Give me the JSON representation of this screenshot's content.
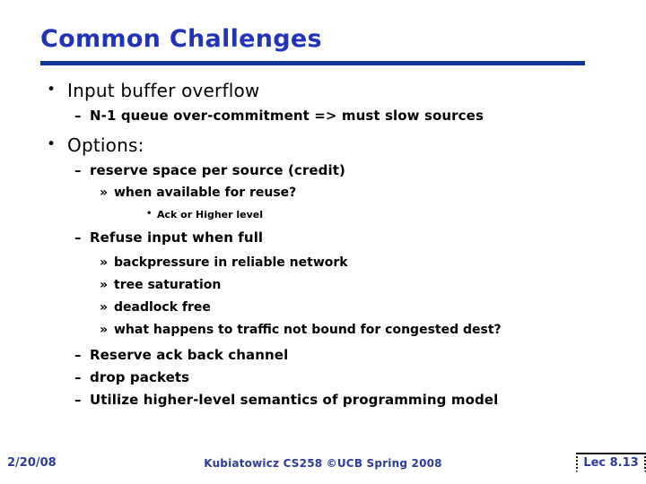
{
  "slide": {
    "title": "Common Challenges",
    "title_color": "#2233bb",
    "rule_color": "#123399",
    "outline": [
      {
        "level": 1,
        "bullet": "•",
        "text": "Input buffer overflow"
      },
      {
        "level": 2,
        "bullet": "–",
        "text": "N-1 queue over-commitment => must slow sources"
      },
      {
        "level": 1,
        "bullet": "•",
        "text": "Options:"
      },
      {
        "level": 2,
        "bullet": "–",
        "text": "reserve space per source  (credit)"
      },
      {
        "level": 3,
        "bullet": "»",
        "text": "when available for reuse?"
      },
      {
        "level": 4,
        "bullet": "•",
        "text": "Ack or Higher level"
      },
      {
        "level": 2,
        "bullet": "–",
        "text": "Refuse input when full"
      },
      {
        "level": 3,
        "bullet": "»",
        "text": "backpressure in reliable network"
      },
      {
        "level": 3,
        "bullet": "»",
        "text": "tree saturation"
      },
      {
        "level": 3,
        "bullet": "»",
        "text": "deadlock free"
      },
      {
        "level": 3,
        "bullet": "»",
        "text": "what happens to traffic not bound for congested dest?"
      },
      {
        "level": 2,
        "bullet": "–",
        "text": "Reserve ack back channel"
      },
      {
        "level": 2,
        "bullet": "–",
        "text": "drop packets"
      },
      {
        "level": 2,
        "bullet": "–",
        "text": "Utilize higher-level semantics of programming model"
      }
    ]
  },
  "footer": {
    "date": "2/20/08",
    "center": "Kubiatowicz CS258 ©UCB Spring 2008",
    "page": "Lec 8.13",
    "text_color": "#2e3b9e"
  }
}
